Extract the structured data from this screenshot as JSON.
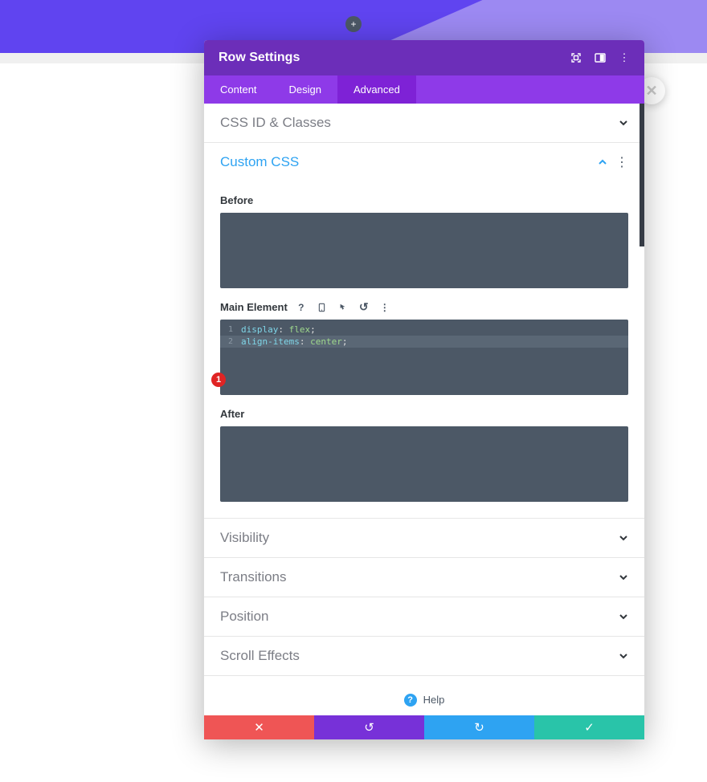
{
  "modal": {
    "title": "Row Settings",
    "tabs": {
      "content": "Content",
      "design": "Design",
      "advanced": "Advanced"
    }
  },
  "accordion": {
    "css_id": "CSS ID & Classes",
    "custom_css": "Custom CSS",
    "visibility": "Visibility",
    "transitions": "Transitions",
    "position": "Position",
    "scroll_effects": "Scroll Effects"
  },
  "fields": {
    "before": "Before",
    "main_element": "Main Element",
    "after": "After"
  },
  "code": {
    "line1": {
      "prop": "display",
      "val": "flex"
    },
    "line2": {
      "prop": "align-items",
      "val": "center"
    },
    "num1": "1",
    "num2": "2"
  },
  "help": "Help",
  "marker1": "1",
  "icons": {
    "add": "+",
    "help_q": "?",
    "close": "✕",
    "check": "✓",
    "dots": "⋮",
    "undo": "↺",
    "redo": "↻"
  }
}
